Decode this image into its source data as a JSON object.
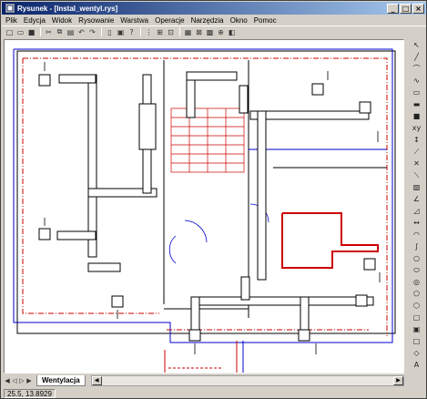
{
  "window": {
    "title": "Rysunek - [Instal_wentyl.rys]",
    "buttons": [
      "_",
      "□",
      "×"
    ]
  },
  "menu": {
    "items": [
      "Plik",
      "Edycja",
      "Widok",
      "Rysowanie",
      "Warstwa",
      "Operacje",
      "Narzędzia",
      "Okno",
      "Pomoc"
    ]
  },
  "tabs": {
    "active": "Wentylacja"
  },
  "status": {
    "coords": "25.5, 13.8929"
  },
  "colors": {
    "duct": "#000000",
    "wall_blue": "#0000cc",
    "wall_red": "#cc0000",
    "title_start": "#0a246a"
  }
}
